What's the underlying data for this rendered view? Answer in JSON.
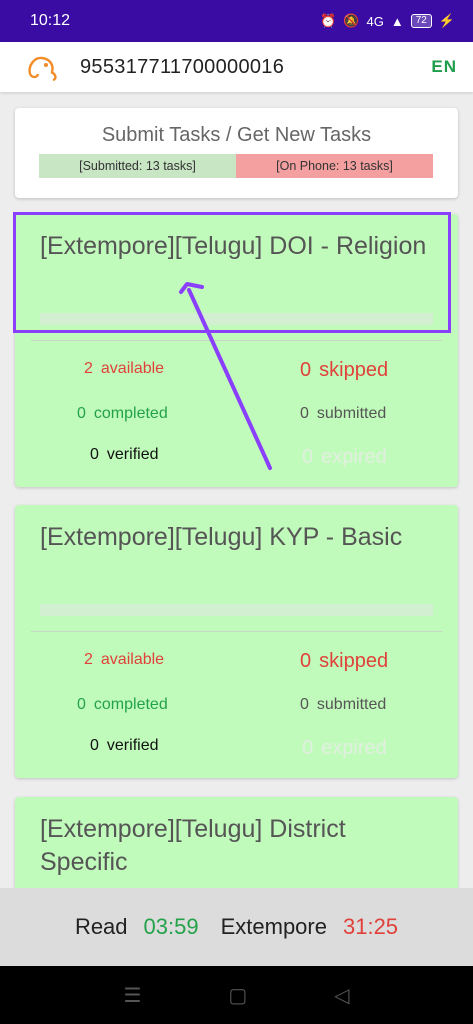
{
  "status_bar": {
    "time": "10:12",
    "battery": "72",
    "network": "4G"
  },
  "app_bar": {
    "phone_number": "955317711700000016",
    "language": "EN"
  },
  "submit_card": {
    "title": "Submit Tasks / Get New Tasks",
    "submitted_label": "[Submitted: 13 tasks]",
    "on_phone_label": "[On Phone: 13  tasks]"
  },
  "tasks": [
    {
      "name": "[Extempore][Telugu] DOI - Religion",
      "available": "2",
      "available_label": "available",
      "skipped": "0",
      "skipped_label": "skipped",
      "completed": "0",
      "completed_label": "completed",
      "submitted": "0",
      "submitted_label": "submitted",
      "verified": "0",
      "verified_label": "verified",
      "expired": "0",
      "expired_label": "expired"
    },
    {
      "name": "[Extempore][Telugu] KYP - Basic",
      "available": "2",
      "available_label": "available",
      "skipped": "0",
      "skipped_label": "skipped",
      "completed": "0",
      "completed_label": "completed",
      "submitted": "0",
      "submitted_label": "submitted",
      "verified": "0",
      "verified_label": "verified",
      "expired": "0",
      "expired_label": "expired"
    },
    {
      "name": "[Extempore][Telugu] District Specific"
    }
  ],
  "timers": {
    "read_label": "Read",
    "read_time": "03:59",
    "extempore_label": "Extempore",
    "extempore_time": "31:25"
  },
  "colors": {
    "status_bar": "#3a0ca3",
    "card_green": "#c1fbbb",
    "accent_red": "#e0413a",
    "accent_green": "#23a24a",
    "highlight_purple": "#8a3ffc"
  }
}
